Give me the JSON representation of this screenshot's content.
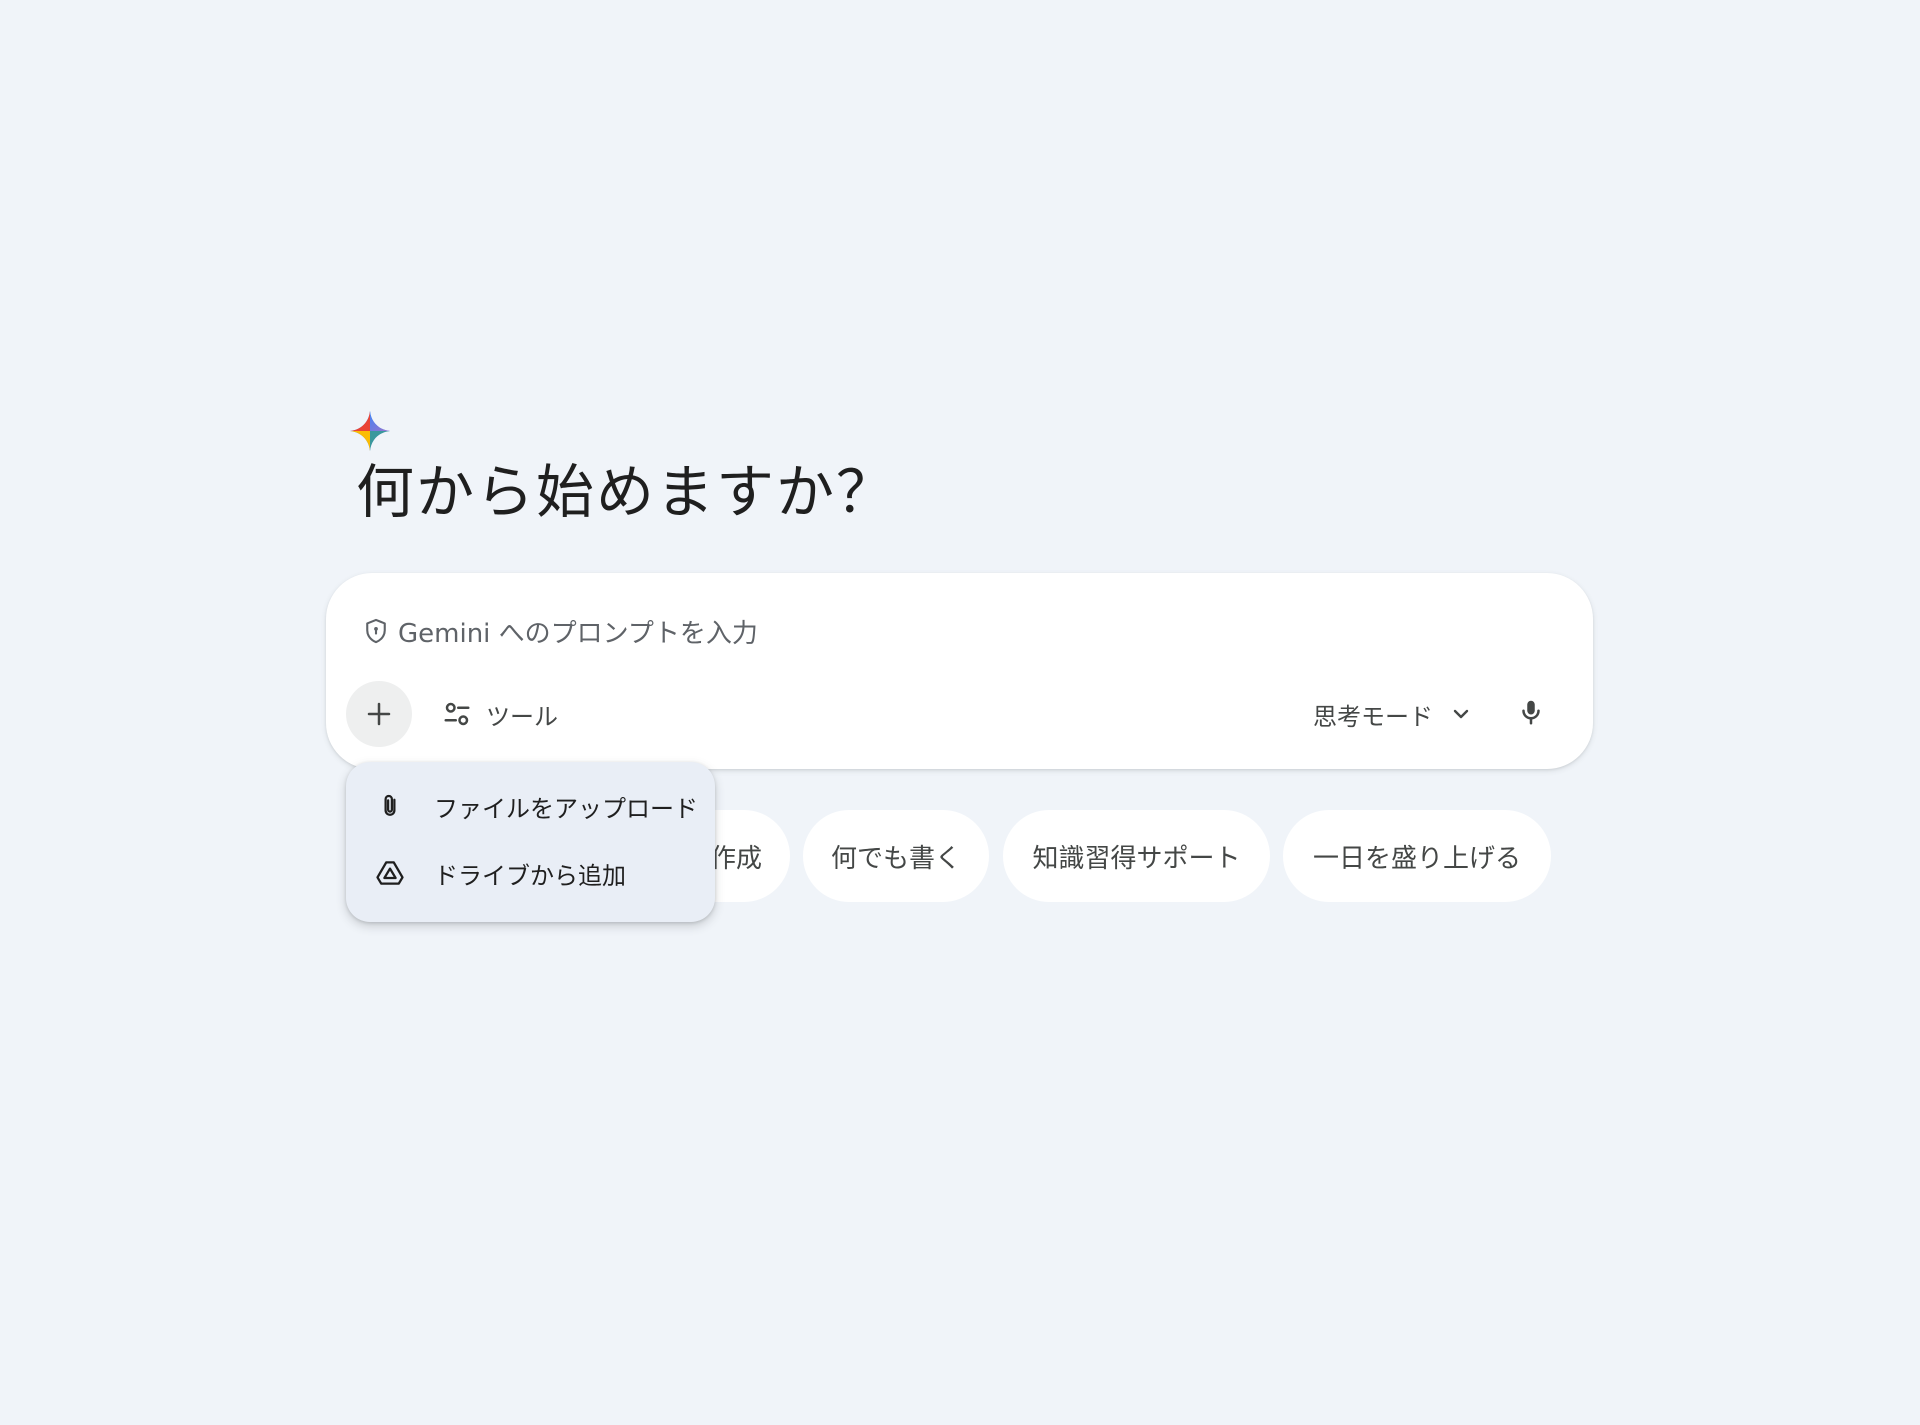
{
  "greeting": "何から始めますか？",
  "prompt": {
    "placeholder": "Gemini へのプロンプトを入力"
  },
  "toolbar": {
    "tools_label": "ツール",
    "mode_label": "思考モード"
  },
  "chips": [
    {
      "label": "作成"
    },
    {
      "label": "何でも書く"
    },
    {
      "label": "知識習得サポート"
    },
    {
      "label": "一日を盛り上げる"
    }
  ],
  "menu": {
    "items": [
      {
        "label": "ファイルをアップロード",
        "icon": "paperclip-icon"
      },
      {
        "label": "ドライブから追加",
        "icon": "drive-icon"
      }
    ]
  },
  "colors": {
    "background": "#f0f4f9",
    "surface": "#ffffff",
    "menu_surface": "#e9eef6",
    "text_primary": "#1f1f1f",
    "text_secondary": "#444746"
  }
}
